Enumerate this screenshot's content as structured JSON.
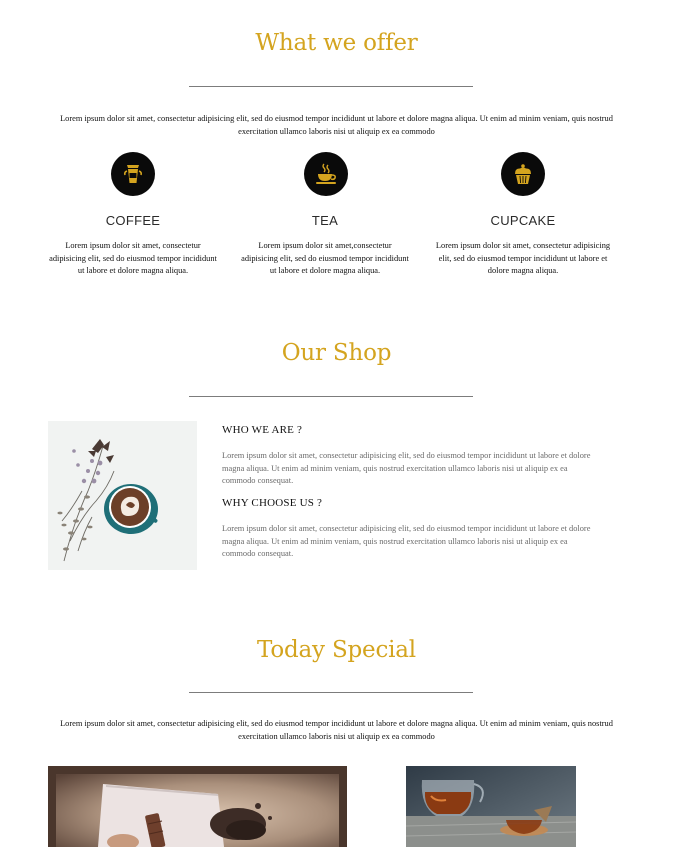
{
  "offer": {
    "title": "What we offer",
    "intro": "Lorem ipsum dolor sit amet, consectetur adipisicing elit, sed do eiusmod tempor incididunt ut labore et dolore magna aliqua. Ut enim ad minim veniam, quis nostrud exercitation ullamco laboris nisi ut aliquip ex ea commodo",
    "items": [
      {
        "icon": "coffee-cup-icon",
        "title": "COFFEE",
        "text": "Lorem ipsum dolor sit amet, consectetur adipisicing elit, sed do eiusmod tempor incididunt ut labore et dolore magna aliqua."
      },
      {
        "icon": "tea-cup-icon",
        "title": "TEA",
        "text": "Lorem ipsum dolor sit amet,consectetur adipisicing elit, sed do eiusmod tempor incididunt ut labore et dolore magna aliqua."
      },
      {
        "icon": "cupcake-icon",
        "title": "CUPCAKE",
        "text": "Lorem ipsum dolor sit amet, consectetur adipisicing elit, sed do eiusmod tempor incididunt ut labore et dolore magna aliqua."
      }
    ]
  },
  "shop": {
    "title": "Our Shop",
    "who_title": "WHO WE ARE ?",
    "who_text": "Lorem ipsum dolor sit amet, consectetur adipisicing elit, sed do eiusmod tempor incididunt ut labore et dolore magna aliqua. Ut enim ad minim veniam, quis nostrud exercitation ullamco laboris nisi ut aliquip ex ea commodo consequat.",
    "why_title": "WHY CHOOSE US ?",
    "why_text": "Lorem ipsum dolor sit amet, consectetur adipisicing elit, sed do eiusmod tempor incididunt ut labore et dolore magna aliqua. Ut enim ad minim veniam, quis nostrud exercitation ullamco laboris nisi ut aliquip ex ea commodo consequat."
  },
  "special": {
    "title": "Today Special",
    "intro": "Lorem ipsum dolor sit amet, consectetur adipisicing elit, sed do eiusmod tempor incididunt ut labore et dolore magna aliqua. Ut enim ad minim veniam, quis nostrud exercitation ullamco laboris nisi ut aliquip ex ea commodo"
  },
  "colors": {
    "accent": "#d4a41f",
    "icon_background": "#0a0a0a",
    "rule": "#7c7c7c",
    "muted_text": "#6b6b6b"
  }
}
